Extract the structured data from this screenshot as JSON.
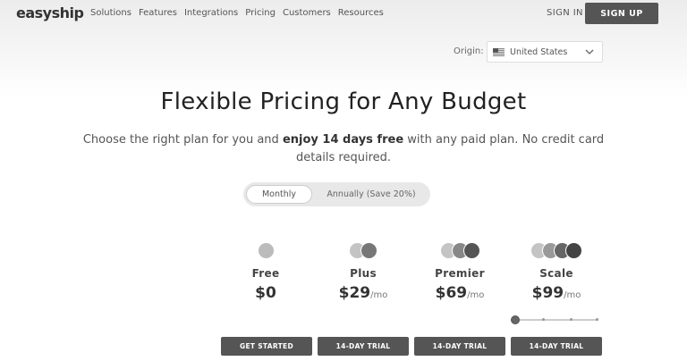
{
  "brand": {
    "name": "easyship"
  },
  "nav": {
    "links": [
      "Solutions",
      "Features",
      "Integrations",
      "Pricing",
      "Customers",
      "Resources"
    ],
    "sign_in": "SIGN IN",
    "sign_up": "SIGN UP"
  },
  "origin": {
    "label": "Origin:",
    "value": "United States",
    "flag_icon": "us-flag-icon"
  },
  "hero": {
    "title": "Flexible Pricing for Any Budget",
    "subtitle_pre": "Choose the right plan for you and ",
    "subtitle_bold": "enjoy 14 days free",
    "subtitle_post": " with any paid plan. No credit card details required."
  },
  "billing_toggle": {
    "options": [
      "Monthly",
      "Annually (Save 20%)"
    ],
    "selected": "Monthly"
  },
  "plans": [
    {
      "name": "Free",
      "price": "$0",
      "per": "",
      "cta": "GET STARTED",
      "dot_colors": [
        "#bbbbbb"
      ]
    },
    {
      "name": "Plus",
      "price": "$29",
      "per": "/mo",
      "cta": "14-DAY TRIAL",
      "dot_colors": [
        "#c4c4c4",
        "#777777"
      ]
    },
    {
      "name": "Premier",
      "price": "$69",
      "per": "/mo",
      "cta": "14-DAY TRIAL",
      "dot_colors": [
        "#c4c4c4",
        "#888888",
        "#555555"
      ]
    },
    {
      "name": "Scale",
      "price": "$99",
      "per": "/mo",
      "cta": "14-DAY TRIAL",
      "dot_colors": [
        "#c4c4c4",
        "#999999",
        "#666666",
        "#444444"
      ]
    }
  ],
  "scale_slider": {
    "value": 0
  },
  "colors": {
    "button_bg": "#555555",
    "text_dark": "#333333"
  }
}
